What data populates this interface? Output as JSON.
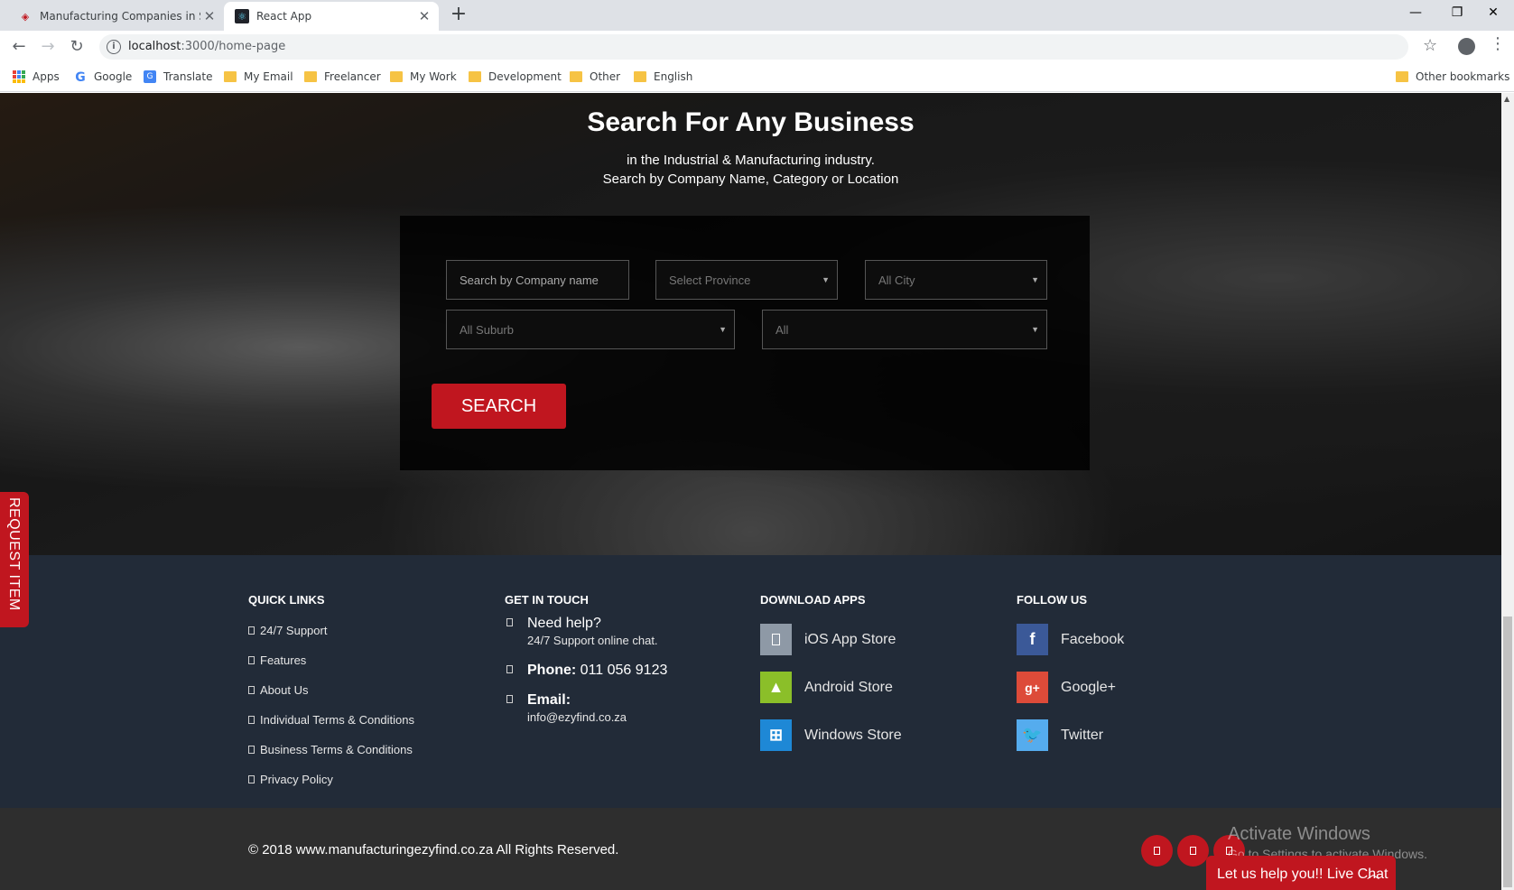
{
  "browser": {
    "tabs": [
      {
        "title": "Manufacturing Companies in Sou",
        "active": false
      },
      {
        "title": "React App",
        "active": true
      }
    ],
    "url_host": "localhost",
    "url_path": ":3000/home-page",
    "bookmarks": [
      "Apps",
      "Google",
      "Translate",
      "My Email",
      "Freelancer",
      "My Work",
      "Development",
      "Other",
      "English"
    ],
    "other_bookmarks": "Other bookmarks"
  },
  "hero": {
    "title": "Search For Any Business",
    "subtitle_line1": "in the Industrial & Manufacturing industry.",
    "subtitle_line2": "Search by Company Name, Category or Location",
    "company_placeholder": "Search by Company name",
    "province_select": "Select Province",
    "city_select": "All City",
    "suburb_select": "All Suburb",
    "category_select": "All",
    "search_label": "SEARCH"
  },
  "request_item_label": "REQUEST ITEM",
  "footer": {
    "quick_links": {
      "title": "QUICK LINKS",
      "items": [
        "24/7 Support",
        "Features",
        "About Us",
        "Individual Terms & Conditions",
        "Business Terms & Conditions",
        "Privacy Policy"
      ]
    },
    "get_in_touch": {
      "title": "GET IN TOUCH",
      "help_heading": "Need help?",
      "help_text": "24/7 Support online chat.",
      "phone_label": "Phone:",
      "phone_value": "011 056 9123",
      "email_label": "Email:",
      "email_value": "info@ezyfind.co.za"
    },
    "download_apps": {
      "title": "DOWNLOAD APPS",
      "items": [
        "iOS App Store",
        "Android Store",
        "Windows Store"
      ]
    },
    "follow_us": {
      "title": "FOLLOW US",
      "items": [
        "Facebook",
        "Google+",
        "Twitter"
      ]
    },
    "copyright": "© 2018 www.manufacturingezyfind.co.za All Rights Reserved."
  },
  "windows_watermark": {
    "line1": "Activate Windows",
    "line2": "Go to Settings to activate Windows."
  },
  "live_chat_label": "Let us help you!! Live Chat",
  "colors": {
    "accent_red": "#c0161f",
    "footer_bg": "#222b38",
    "bottom_bg": "#2e2e2e"
  }
}
